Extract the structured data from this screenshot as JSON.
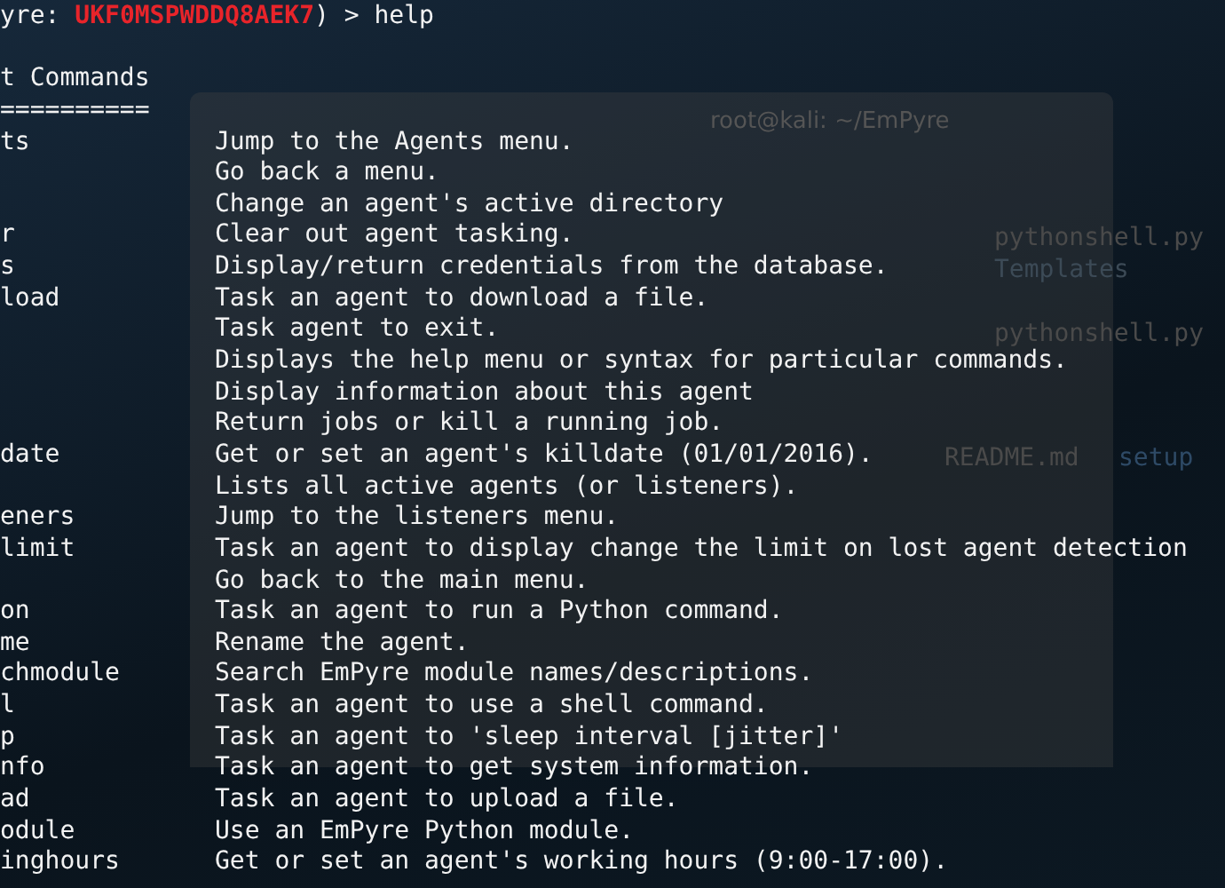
{
  "prompt": {
    "prefix": "yre: ",
    "agent": "UKF0MSPWDDQ8AEK7",
    "suffix": ") > help"
  },
  "heading": "t Commands",
  "rule": "==========",
  "background_window": {
    "title": "root@kali: ~/EmPyre",
    "files": [
      "pythonshell.py",
      "Templates",
      "pythonshell.py",
      "README.md",
      "setup"
    ]
  },
  "commands": [
    {
      "name": "ts",
      "description": "Jump to the Agents menu."
    },
    {
      "description": "Go back a menu."
    },
    {
      "description": "Change an agent's active directory"
    },
    {
      "name": "r",
      "description": "Clear out agent tasking."
    },
    {
      "name": "s",
      "description": "Display/return credentials from the database."
    },
    {
      "name": "load",
      "description": "Task an agent to download a file."
    },
    {
      "description": "Task agent to exit."
    },
    {
      "description": "Displays the help menu or syntax for particular commands."
    },
    {
      "description": "Display information about this agent"
    },
    {
      "description": "Return jobs or kill a running job."
    },
    {
      "name": "date",
      "description": "Get or set an agent's killdate (01/01/2016)."
    },
    {
      "description": "Lists all active agents (or listeners)."
    },
    {
      "name": "eners",
      "description": "Jump to the listeners menu."
    },
    {
      "name": "limit",
      "description": "Task an agent to display change the limit on lost agent detection"
    },
    {
      "description": "Go back to the main menu."
    },
    {
      "name": "on",
      "description": "Task an agent to run a Python command."
    },
    {
      "name": "me",
      "description": "Rename the agent."
    },
    {
      "name": "chmodule",
      "description": "Search EmPyre module names/descriptions."
    },
    {
      "name": "l",
      "description": "Task an agent to use a shell command."
    },
    {
      "name": "p",
      "description": "Task an agent to 'sleep interval [jitter]'"
    },
    {
      "name": "nfo",
      "description": "Task an agent to get system information."
    },
    {
      "name": "ad",
      "description": "Task an agent to upload a file."
    },
    {
      "name": "odule",
      "description": "Use an EmPyre Python module."
    },
    {
      "name": "inghours",
      "description": "Get or set an agent's working hours (9:00-17:00)."
    }
  ]
}
